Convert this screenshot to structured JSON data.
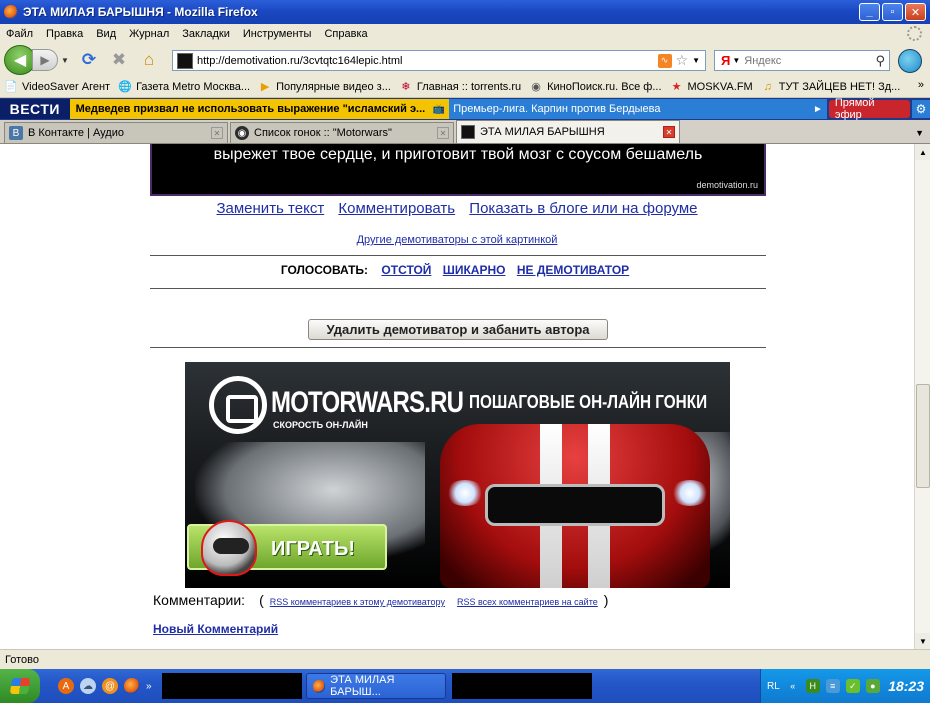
{
  "window": {
    "title": "ЭТА МИЛАЯ БАРЫШНЯ - Mozilla Firefox",
    "minimize": "_",
    "maximize": "▫",
    "close": "✕"
  },
  "menu": [
    "Файл",
    "Правка",
    "Вид",
    "Журнал",
    "Закладки",
    "Инструменты",
    "Справка"
  ],
  "nav": {
    "url": "http://demotivation.ru/3cvtqtc164lepic.html",
    "search_placeholder": "Яндекс",
    "search_engine": "Я"
  },
  "bookmarks": [
    {
      "label": "VideoSaver Агент",
      "icon": "page-icon"
    },
    {
      "label": "Газета Metro Москва...",
      "icon": "globe-icon"
    },
    {
      "label": "Популярные видео з...",
      "icon": "play-icon"
    },
    {
      "label": "Главная :: torrents.ru",
      "icon": "bug-icon"
    },
    {
      "label": "КиноПоиск.ru. Все ф...",
      "icon": "film-icon"
    },
    {
      "label": "MOSKVA.FM",
      "icon": "star-icon"
    },
    {
      "label": "ТУТ ЗАЙЦЕВ НЕТ! Зд...",
      "icon": "music-icon"
    }
  ],
  "bookmarks_more": "»",
  "news": {
    "brand": "ВЕСТИ",
    "headline1": "Медведев призвал не использовать выражение \"исламский э...",
    "headline2": "Премьер-лига. Карпин против Бердыева",
    "live": "Прямой эфир"
  },
  "tabs": [
    {
      "label": "В Контакте | Аудио",
      "icon": "vk-icon",
      "active": false
    },
    {
      "label": "Список гонок :: \"Motorwars\"",
      "icon": "motorwars-icon",
      "active": false
    },
    {
      "label": "ЭТА МИЛАЯ БАРЫШНЯ",
      "icon": "page-icon",
      "active": true
    }
  ],
  "page": {
    "caption": "вырежет твое сердце, и приготовит твой мозг с соусом  бешамель",
    "watermark": "demotivation.ru",
    "links": [
      "Заменить текст",
      "Комментировать",
      "Показать в блоге или на форуме"
    ],
    "other": "Другие демотиваторы с этой картинкой",
    "vote_label": "ГОЛОСОВАТЬ:",
    "vote_options": [
      "ОТСТОЙ",
      "ШИКАРНО",
      "НЕ ДЕМОТИВАТОР"
    ],
    "delete_button": "Удалить демотиватор и забанить автора",
    "banner": {
      "brand": "MOTORWARS.RU",
      "brand_sub": "СКОРОСТЬ ОН-ЛАЙН",
      "tagline": "ПОШАГОВЫЕ ОН-ЛАЙН ГОНКИ",
      "play": "ИГРАТЬ!"
    },
    "comments_label": "Комментарии:",
    "rss1": "RSS комментариев к этому демотиватору",
    "rss2": "RSS всех комментариев на сайте",
    "paren_open": "(",
    "paren_close": ")",
    "new_comment": "Новый Комментарий"
  },
  "status": "Готово",
  "taskbar": {
    "item": "ЭТА МИЛАЯ БАРЫШ...",
    "lang": "RL",
    "clock": "18:23",
    "more": "»"
  },
  "colors": {
    "link": "#1f2ea8",
    "news_yellow": "#f5c400",
    "live_red": "#c9252c",
    "taskbar_blue": "#2457c8"
  }
}
